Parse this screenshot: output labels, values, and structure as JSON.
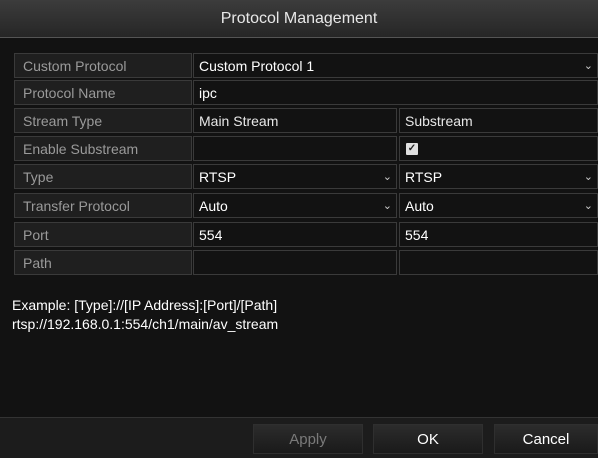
{
  "dialog": {
    "title": "Protocol Management"
  },
  "rows": {
    "custom_protocol": {
      "label": "Custom Protocol",
      "value": "Custom Protocol 1"
    },
    "protocol_name": {
      "label": "Protocol Name",
      "value": "ipc"
    },
    "stream_type": {
      "label": "Stream Type",
      "main": "Main Stream",
      "sub": "Substream"
    },
    "enable_substream": {
      "label": "Enable Substream",
      "checked_mark": "✓"
    },
    "type": {
      "label": "Type",
      "main": "RTSP",
      "sub": "RTSP"
    },
    "transfer_protocol": {
      "label": "Transfer Protocol",
      "main": "Auto",
      "sub": "Auto"
    },
    "port": {
      "label": "Port",
      "main": "554",
      "sub": "554"
    },
    "path": {
      "label": "Path",
      "main": "",
      "sub": ""
    }
  },
  "example": {
    "line1": "Example: [Type]://[IP Address]:[Port]/[Path]",
    "line2": "rtsp://192.168.0.1:554/ch1/main/av_stream"
  },
  "buttons": {
    "apply": "Apply",
    "ok": "OK",
    "cancel": "Cancel"
  },
  "icons": {
    "dropdown": "chevron-down-icon"
  }
}
